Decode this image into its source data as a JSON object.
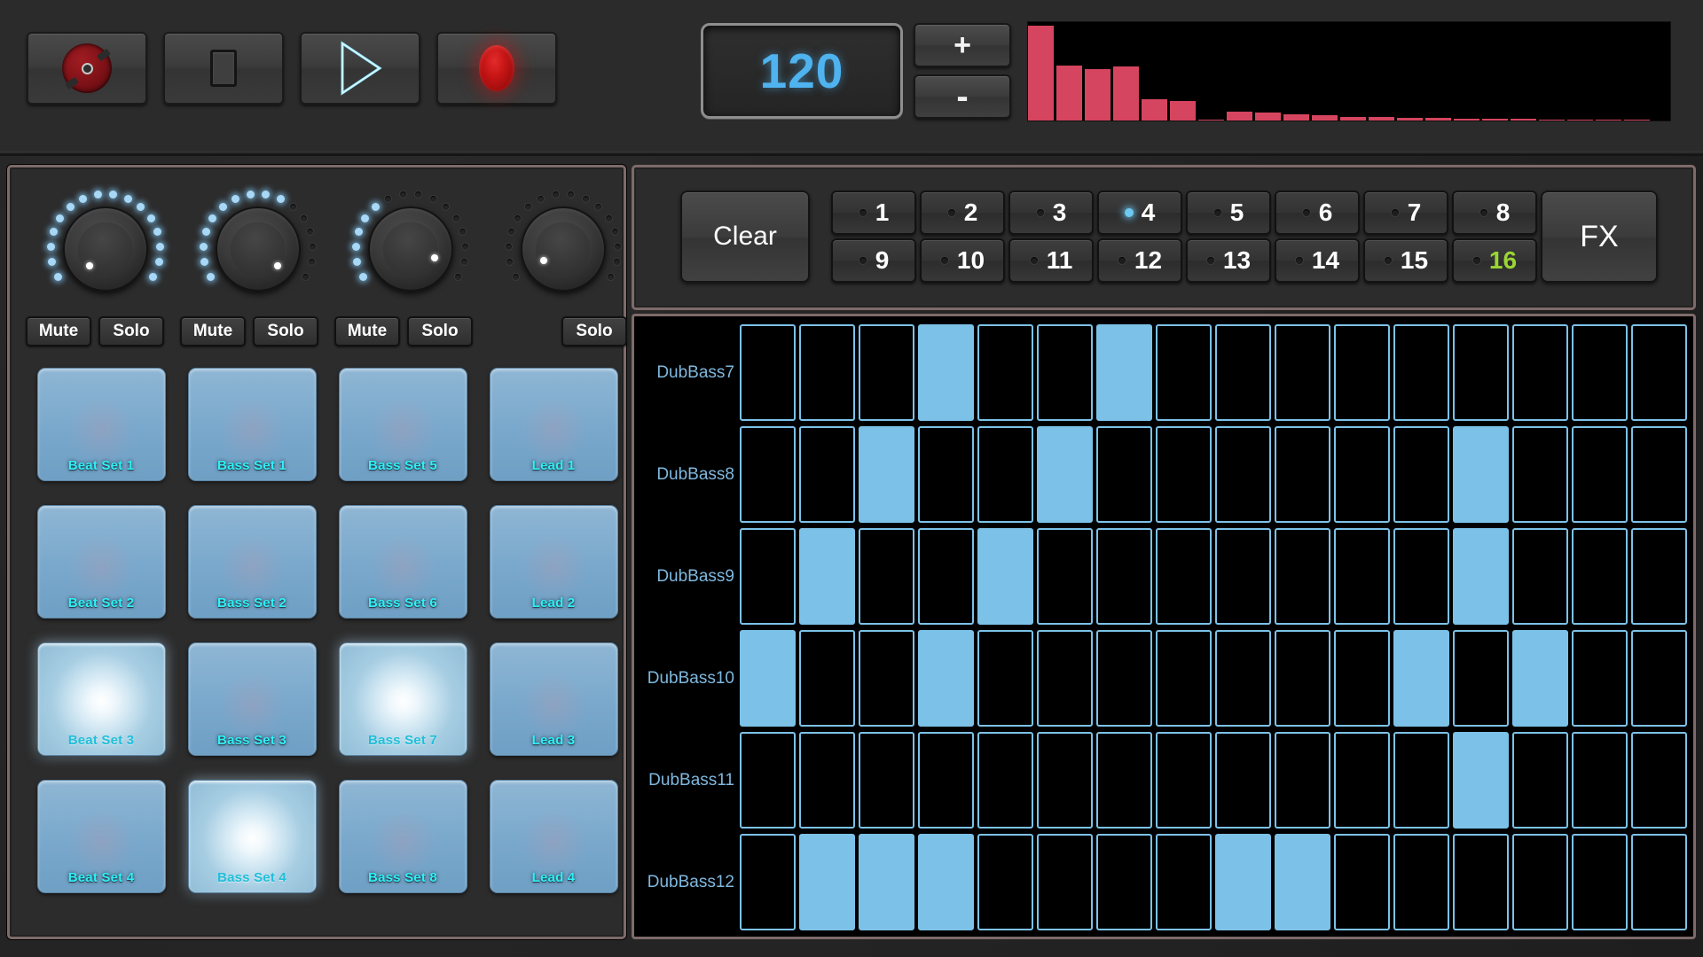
{
  "transport": {
    "buttons": [
      {
        "name": "rewind-disc-button",
        "icon": "disc-icon",
        "label": ""
      },
      {
        "name": "stop-button",
        "icon": "stop-icon",
        "label": ""
      },
      {
        "name": "play-button",
        "icon": "play-icon",
        "label": ""
      },
      {
        "name": "record-button",
        "icon": "record-icon",
        "label": ""
      }
    ]
  },
  "bpm": {
    "value": "120",
    "increase_label": "+",
    "decrease_label": "-"
  },
  "analyzer": {
    "accent_color": "#d6455f",
    "background_color": "#000000",
    "bar_count": 22,
    "values": [
      96,
      56,
      52,
      55,
      22,
      20,
      0,
      9,
      8,
      6,
      5,
      4,
      4,
      3,
      3,
      2,
      2,
      2,
      1,
      1,
      1,
      1
    ]
  },
  "mixer": {
    "channels": [
      {
        "knob_name": "knob-channel-1",
        "leds_on": 16,
        "leds_total": 16,
        "dot_angle": 140,
        "mute_label": "Mute",
        "solo_label": "Solo",
        "has_mute": true
      },
      {
        "knob_name": "knob-channel-2",
        "leds_on": 10,
        "leds_total": 16,
        "dot_angle": 40,
        "mute_label": "Mute",
        "solo_label": "Solo",
        "has_mute": true
      },
      {
        "knob_name": "knob-channel-3",
        "leds_on": 6,
        "leds_total": 16,
        "dot_angle": 18,
        "mute_label": "Mute",
        "solo_label": "Solo",
        "has_mute": true
      },
      {
        "knob_name": "knob-channel-4",
        "leds_on": 0,
        "leds_total": 16,
        "dot_angle": 155,
        "mute_label": "",
        "solo_label": "Solo",
        "has_mute": false
      }
    ]
  },
  "pads": {
    "rows": [
      [
        {
          "label": "Beat Set 1",
          "active": false
        },
        {
          "label": "Bass Set 1",
          "active": false
        },
        {
          "label": "Bass Set 5",
          "active": false
        },
        {
          "label": "Lead 1",
          "active": false
        }
      ],
      [
        {
          "label": "Beat Set 2",
          "active": false
        },
        {
          "label": "Bass Set 2",
          "active": false
        },
        {
          "label": "Bass Set 6",
          "active": false
        },
        {
          "label": "Lead 2",
          "active": false
        }
      ],
      [
        {
          "label": "Beat Set 3",
          "active": true
        },
        {
          "label": "Bass Set 3",
          "active": false
        },
        {
          "label": "Bass Set 7",
          "active": true
        },
        {
          "label": "Lead 3",
          "active": false
        }
      ],
      [
        {
          "label": "Beat Set 4",
          "active": false
        },
        {
          "label": "Bass Set 4",
          "active": true
        },
        {
          "label": "Bass Set 8",
          "active": false
        },
        {
          "label": "Lead 4",
          "active": false
        }
      ]
    ]
  },
  "patterns": {
    "clear_label": "Clear",
    "fx_label": "FX",
    "selected": 4,
    "green_highlight": 16,
    "buttons": [
      {
        "label": "1",
        "selected": false,
        "green": false
      },
      {
        "label": "2",
        "selected": false,
        "green": false
      },
      {
        "label": "3",
        "selected": false,
        "green": false
      },
      {
        "label": "4",
        "selected": true,
        "green": false
      },
      {
        "label": "5",
        "selected": false,
        "green": false
      },
      {
        "label": "6",
        "selected": false,
        "green": false
      },
      {
        "label": "7",
        "selected": false,
        "green": false
      },
      {
        "label": "8",
        "selected": false,
        "green": false
      },
      {
        "label": "9",
        "selected": false,
        "green": false
      },
      {
        "label": "10",
        "selected": false,
        "green": false
      },
      {
        "label": "11",
        "selected": false,
        "green": false
      },
      {
        "label": "12",
        "selected": false,
        "green": false
      },
      {
        "label": "13",
        "selected": false,
        "green": false
      },
      {
        "label": "14",
        "selected": false,
        "green": false
      },
      {
        "label": "15",
        "selected": false,
        "green": false
      },
      {
        "label": "16",
        "selected": false,
        "green": true
      }
    ]
  },
  "sequencer": {
    "step_count": 16,
    "step_on_color": "#7cc2e8",
    "label_color": "#7fb8df",
    "tracks": [
      {
        "name": "DubBass7",
        "steps": [
          0,
          0,
          0,
          1,
          0,
          0,
          1,
          0,
          0,
          0,
          0,
          0,
          0,
          0,
          0,
          0
        ]
      },
      {
        "name": "DubBass8",
        "steps": [
          0,
          0,
          1,
          0,
          0,
          1,
          0,
          0,
          0,
          0,
          0,
          0,
          1,
          0,
          0,
          0
        ]
      },
      {
        "name": "DubBass9",
        "steps": [
          0,
          1,
          0,
          0,
          1,
          0,
          0,
          0,
          0,
          0,
          0,
          0,
          1,
          0,
          0,
          0
        ]
      },
      {
        "name": "DubBass10",
        "steps": [
          1,
          0,
          0,
          1,
          0,
          0,
          0,
          0,
          0,
          0,
          0,
          1,
          0,
          1,
          0,
          0
        ]
      },
      {
        "name": "DubBass11",
        "steps": [
          0,
          0,
          0,
          0,
          0,
          0,
          0,
          0,
          0,
          0,
          0,
          0,
          1,
          0,
          0,
          0
        ]
      },
      {
        "name": "DubBass12",
        "steps": [
          0,
          1,
          1,
          1,
          0,
          0,
          0,
          0,
          1,
          1,
          0,
          0,
          0,
          0,
          0,
          0
        ]
      }
    ]
  }
}
